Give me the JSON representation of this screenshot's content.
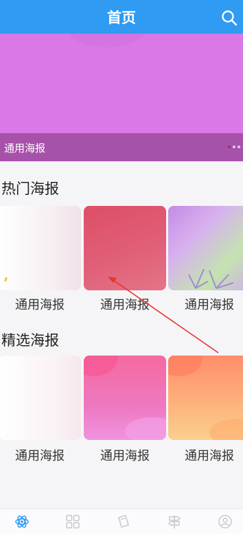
{
  "header": {
    "title": "首页"
  },
  "banner": {
    "caption": "通用海报"
  },
  "sections": [
    {
      "title": "热门海报",
      "cards": [
        {
          "label": "通用海报"
        },
        {
          "label": "通用海报"
        },
        {
          "label": "通用海报"
        }
      ]
    },
    {
      "title": "精选海报",
      "cards": [
        {
          "label": "通用海报"
        },
        {
          "label": "通用海报"
        },
        {
          "label": "通用海报"
        }
      ]
    }
  ],
  "bottom_nav": {
    "items": [
      {
        "icon": "atom-icon",
        "active": true
      },
      {
        "icon": "grid-icon"
      },
      {
        "icon": "book-icon"
      },
      {
        "icon": "signpost-icon"
      },
      {
        "icon": "user-icon"
      }
    ]
  },
  "colors": {
    "primary": "#2f9bf2",
    "nav_active": "#2f9bf2",
    "nav_inactive": "#c8c8cc",
    "annotation": "#e8332a"
  }
}
